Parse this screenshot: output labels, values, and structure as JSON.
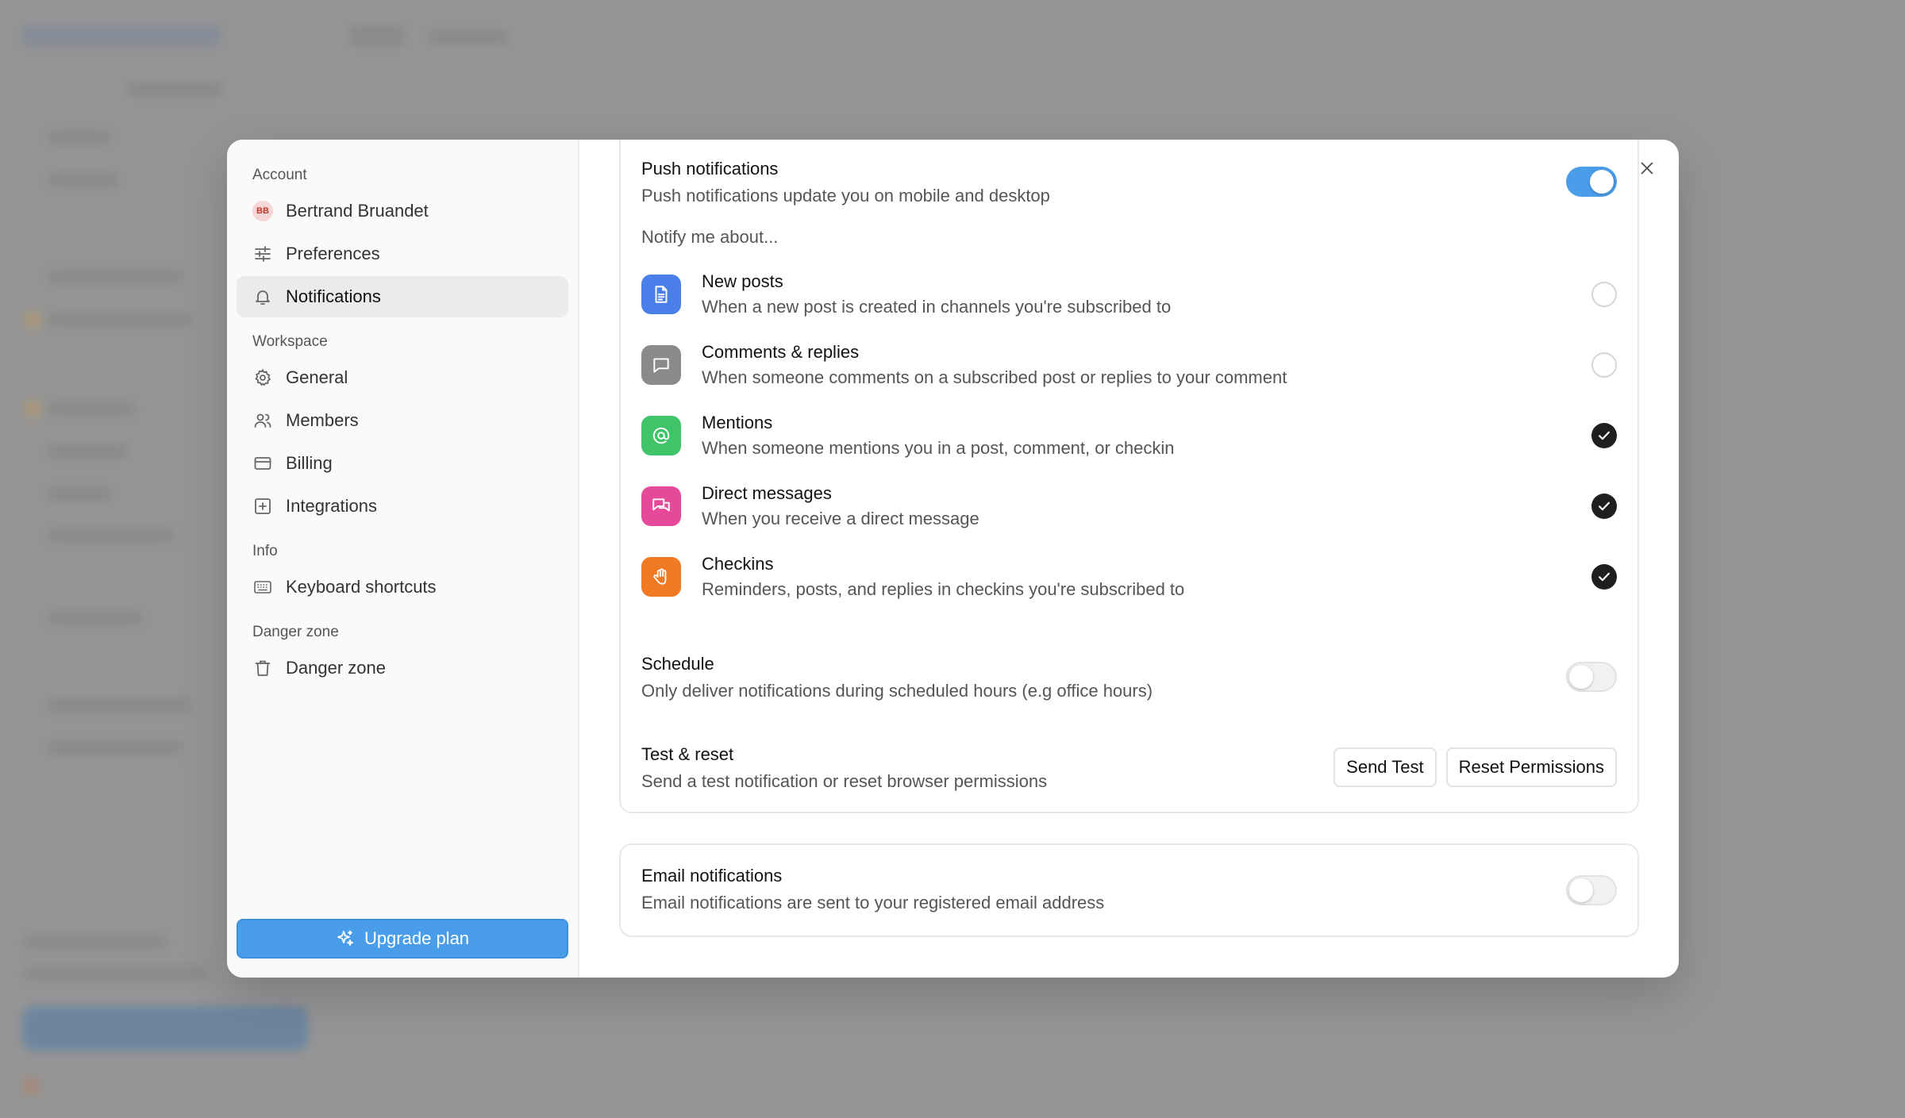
{
  "sidebar": {
    "sections": {
      "account": "Account",
      "workspace": "Workspace",
      "info": "Info",
      "danger": "Danger zone"
    },
    "user": {
      "initials": "BB",
      "name": "Bertrand Bruandet"
    },
    "items": {
      "preferences": "Preferences",
      "notifications": "Notifications",
      "general": "General",
      "members": "Members",
      "billing": "Billing",
      "integrations": "Integrations",
      "shortcuts": "Keyboard shortcuts",
      "danger": "Danger zone"
    },
    "upgrade_label": "Upgrade plan"
  },
  "push": {
    "title": "Push notifications",
    "subtitle": "Push notifications update you on mobile and desktop",
    "enabled": true,
    "notify_label": "Notify me about...",
    "items": [
      {
        "title": "New posts",
        "subtitle": "When a new post is created in channels you're subscribed to",
        "checked": false,
        "color": "#4a7ee8",
        "icon": "document-icon"
      },
      {
        "title": "Comments & replies",
        "subtitle": "When someone comments on a subscribed post or replies to your comment",
        "checked": false,
        "color": "#8a8a8a",
        "icon": "comment-icon"
      },
      {
        "title": "Mentions",
        "subtitle": "When someone mentions you in a post, comment, or checkin",
        "checked": true,
        "color": "#3fc46a",
        "icon": "at-icon"
      },
      {
        "title": "Direct messages",
        "subtitle": "When you receive a direct message",
        "checked": true,
        "color": "#e5499a",
        "icon": "chat-icon"
      },
      {
        "title": "Checkins",
        "subtitle": "Reminders, posts, and replies in checkins you're subscribed to",
        "checked": true,
        "color": "#f07a24",
        "icon": "hand-icon"
      }
    ],
    "schedule": {
      "title": "Schedule",
      "subtitle": "Only deliver notifications during scheduled hours (e.g office hours)",
      "enabled": false
    },
    "test": {
      "title": "Test & reset",
      "subtitle": "Send a test notification or reset browser permissions",
      "send_label": "Send Test",
      "reset_label": "Reset Permissions"
    }
  },
  "email": {
    "title": "Email notifications",
    "subtitle": "Email notifications are sent to your registered email address",
    "enabled": false
  }
}
